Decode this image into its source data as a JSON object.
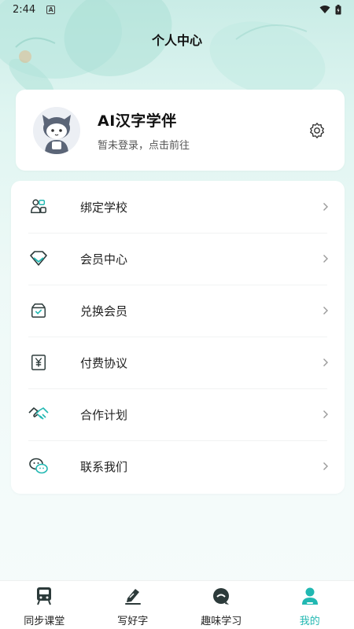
{
  "status_bar": {
    "time": "2:44",
    "notif_letter": "A"
  },
  "header": {
    "title": "个人中心"
  },
  "profile": {
    "name": "AI汉字学伴",
    "subtitle": "暂未登录，点击前往"
  },
  "menu": {
    "items": [
      {
        "label": "绑定学校",
        "icon": "school-bind-icon"
      },
      {
        "label": "会员中心",
        "icon": "diamond-icon"
      },
      {
        "label": "兑换会员",
        "icon": "gift-box-icon"
      },
      {
        "label": "付费协议",
        "icon": "yen-document-icon"
      },
      {
        "label": "合作计划",
        "icon": "handshake-icon"
      },
      {
        "label": "联系我们",
        "icon": "wechat-icon"
      }
    ]
  },
  "tabs": [
    {
      "label": "同步课堂",
      "icon": "train-icon",
      "active": false
    },
    {
      "label": "写好字",
      "icon": "pen-write-icon",
      "active": false
    },
    {
      "label": "趣味学习",
      "icon": "chat-bubble-icon",
      "active": false
    },
    {
      "label": "我的",
      "icon": "person-icon",
      "active": true
    }
  ],
  "colors": {
    "accent": "#21b8b2",
    "icon_dark": "#2c3a3a"
  }
}
